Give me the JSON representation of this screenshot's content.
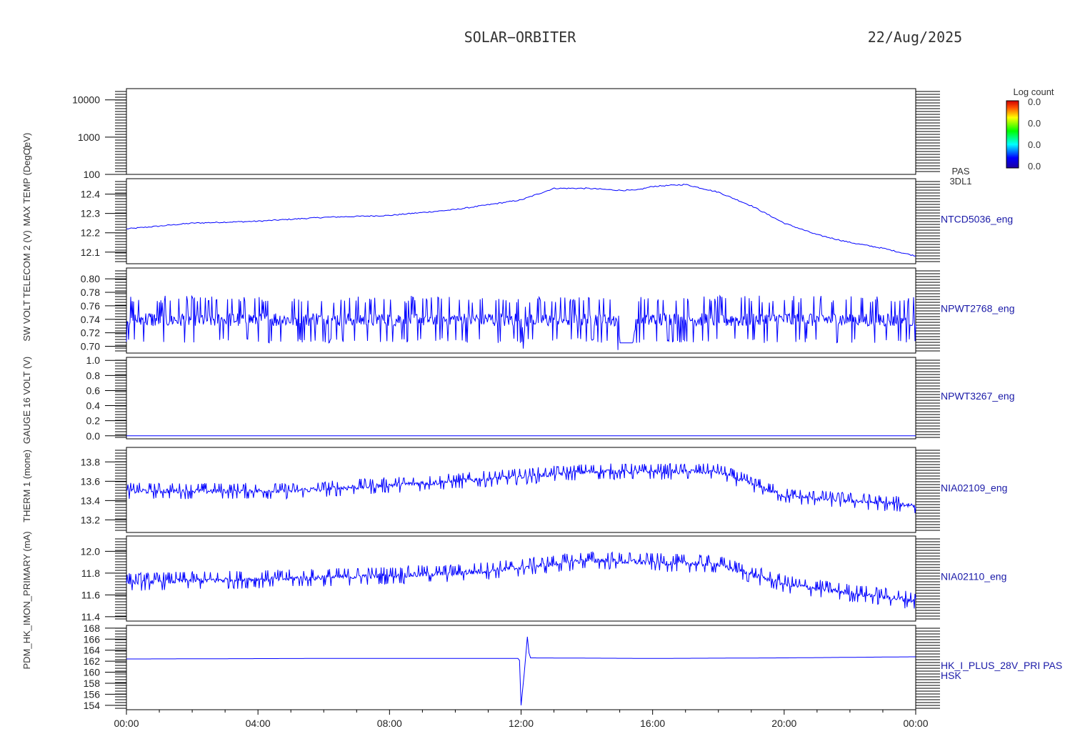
{
  "header": {
    "mission": "SOLAR−ORBITER",
    "date": "22/Aug/2025"
  },
  "colorbar": {
    "title": "Log count",
    "ticks": [
      "0.0",
      "0.0",
      "0.0",
      "0.0"
    ]
  },
  "time_axis": {
    "ticks": [
      "00:00",
      "04:00",
      "08:00",
      "12:00",
      "16:00",
      "20:00",
      "00:00"
    ]
  },
  "ylabels": [
    "(eV)",
    "MAX TEMP (DegC)",
    "SW VOLT TELECOM 2 (V)",
    "GAUGE 16 VOLT (V)",
    "THERM 1 (mone)",
    "PDM_HK_IMON_PRIMARY (mA)"
  ],
  "chart_data": [
    {
      "type": "heatmap",
      "name": "PAS 3DL1",
      "right_label": [
        "PAS",
        "3DL1"
      ],
      "ylabel": "(eV)",
      "yscale": "log",
      "ylim": [
        100,
        20000
      ],
      "yticks": [
        "10000",
        "1000",
        "100"
      ],
      "values": []
    },
    {
      "type": "line",
      "name": "NTCD5036_eng",
      "right_label": [
        "NTCD5036_eng"
      ],
      "ylim": [
        12.04,
        12.48
      ],
      "yticks": [
        "12.4",
        "12.3",
        "12.2",
        "12.1"
      ],
      "ytick_values": [
        12.4,
        12.3,
        12.2,
        12.1
      ],
      "x": [
        0,
        2,
        4,
        6,
        8,
        10,
        12,
        13,
        14,
        15,
        15.5,
        16,
        17,
        18,
        19,
        20,
        21,
        22,
        23,
        24
      ],
      "y": [
        12.22,
        12.25,
        12.26,
        12.28,
        12.29,
        12.32,
        12.37,
        12.43,
        12.43,
        12.42,
        12.42,
        12.44,
        12.45,
        12.41,
        12.34,
        12.25,
        12.19,
        12.15,
        12.12,
        12.08
      ]
    },
    {
      "type": "line",
      "name": "NPWT2768_eng",
      "right_label": [
        "NPWT2768_eng"
      ],
      "ylim": [
        0.69,
        0.816
      ],
      "yticks": [
        "0.80",
        "0.78",
        "0.76",
        "0.74",
        "0.72",
        "0.70"
      ],
      "ytick_values": [
        0.8,
        0.78,
        0.76,
        0.74,
        0.72,
        0.7
      ],
      "baseline": 0.74,
      "noise": 0.05,
      "x": [
        0,
        12,
        12.1,
        12.2,
        14.9,
        15.0,
        15.4,
        15.5,
        24
      ],
      "y": [
        0.74,
        0.74,
        0.72,
        0.74,
        0.74,
        0.705,
        0.705,
        0.74,
        0.74
      ]
    },
    {
      "type": "line",
      "name": "NPWT3267_eng",
      "right_label": [
        "NPWT3267_eng"
      ],
      "ylim": [
        -0.04,
        1.04
      ],
      "yticks": [
        "1.0",
        "0.8",
        "0.6",
        "0.4",
        "0.2",
        "0.0"
      ],
      "ytick_values": [
        1.0,
        0.8,
        0.6,
        0.4,
        0.2,
        0.0
      ],
      "x": [
        0,
        24
      ],
      "y": [
        0.0,
        0.0
      ]
    },
    {
      "type": "line",
      "name": "NIA02109_eng",
      "right_label": [
        "NIA02109_eng"
      ],
      "ylim": [
        13.07,
        13.95
      ],
      "yticks": [
        "13.8",
        "13.6",
        "13.4",
        "13.2"
      ],
      "ytick_values": [
        13.8,
        13.6,
        13.4,
        13.2
      ],
      "noise": 0.12,
      "x": [
        0,
        5,
        10,
        12,
        14,
        16,
        18,
        20,
        22,
        24
      ],
      "y": [
        13.5,
        13.5,
        13.6,
        13.65,
        13.7,
        13.7,
        13.7,
        13.45,
        13.4,
        13.35
      ]
    },
    {
      "type": "line",
      "name": "NIA02110_eng",
      "right_label": [
        "NIA02110_eng"
      ],
      "ylim": [
        11.36,
        12.14
      ],
      "yticks": [
        "12.0",
        "11.8",
        "11.6",
        "11.4"
      ],
      "ytick_values": [
        12.0,
        11.8,
        11.6,
        11.4
      ],
      "noise": 0.12,
      "x": [
        0,
        5,
        10,
        12,
        14,
        16,
        18,
        20,
        22,
        24
      ],
      "y": [
        11.72,
        11.75,
        11.8,
        11.85,
        11.92,
        11.9,
        11.88,
        11.7,
        11.62,
        11.55
      ]
    },
    {
      "type": "line",
      "name": "HK_I_PLUS_28V_PRI PAS HSK",
      "right_label": [
        "HK_I_PLUS_28V_PRI PAS",
        "HSK"
      ],
      "ylim": [
        153.2,
        168.5
      ],
      "yticks": [
        "168",
        "166",
        "164",
        "162",
        "160",
        "158",
        "156",
        "154"
      ],
      "ytick_values": [
        168,
        166,
        164,
        162,
        160,
        158,
        156,
        154
      ],
      "x": [
        0,
        6,
        11.95,
        12.0,
        12.1,
        12.2,
        12.25,
        16,
        20,
        24
      ],
      "y": [
        162.4,
        162.5,
        162.5,
        154.0,
        160.0,
        167.0,
        162.6,
        162.5,
        162.6,
        162.8
      ]
    }
  ]
}
